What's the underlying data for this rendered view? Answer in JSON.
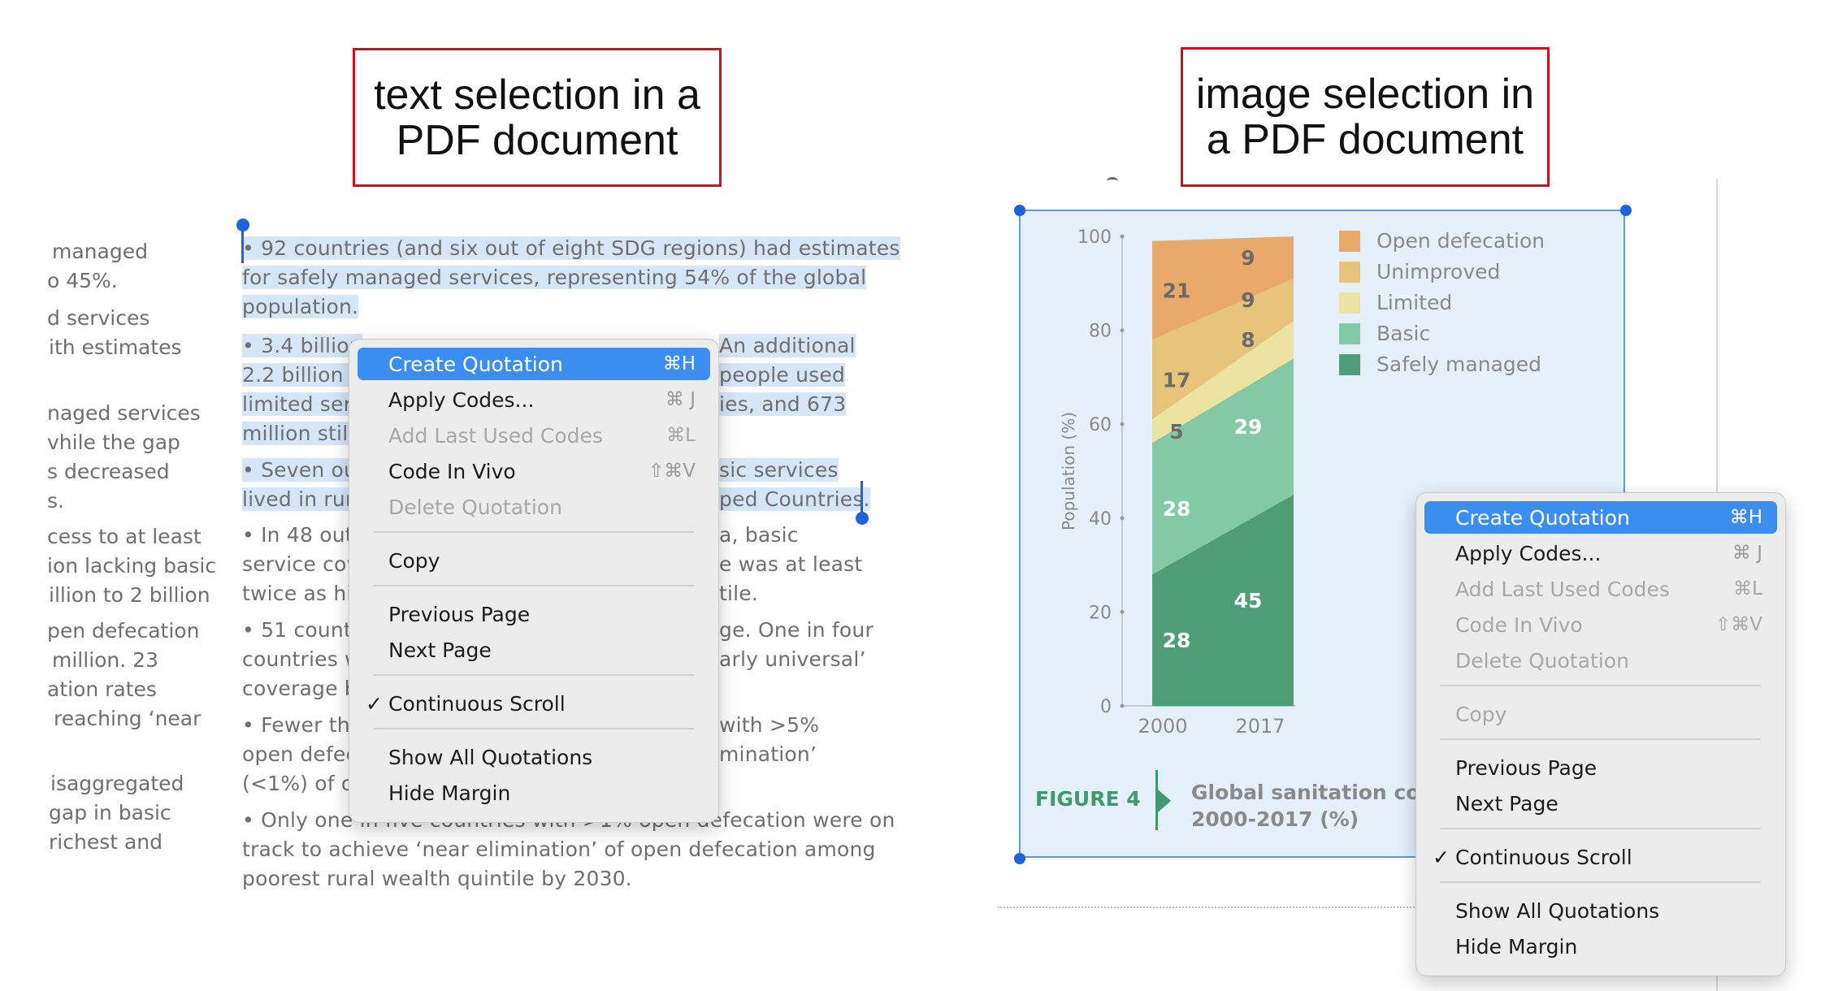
{
  "captions": {
    "left": "text selection in a PDF document",
    "right": "image selection in a PDF document"
  },
  "left_margin_lines": [
    "managed",
    "o 45%.",
    "d services",
    "ith estimates",
    "naged services",
    "vhile the gap",
    "s decreased",
    "s.",
    "cess to at least",
    "ion lacking basic",
    "illion to 2 billion",
    "pen defecation",
    "million. 23",
    "ation rates",
    "reaching ‘near",
    "isaggregated",
    "gap in basic",
    "richest and"
  ],
  "pdf_text": {
    "p1": [
      "•  92 countries (and six out of eight SDG regions) had estimates",
      "for safely managed services, representing 54% of the global",
      "population."
    ],
    "p2_left": [
      "•  3.4 billion",
      "2.2 billion u",
      "limited serv",
      "million still"
    ],
    "p2_right": [
      "An additional",
      "people used",
      "ies, and 673"
    ],
    "p3_left": [
      "•  Seven ou",
      "lived in rura"
    ],
    "p3_right": [
      "sic services",
      "ped Countries."
    ],
    "p4_left": [
      "•  In 48 out",
      "service cov",
      "twice as hig"
    ],
    "p4_right": [
      "a, basic",
      "e was at least",
      "tile."
    ],
    "p5_left": [
      "•  51 count",
      "countries w",
      "coverage b"
    ],
    "p5_right": [
      "ge. One in four",
      "arly universal’"
    ],
    "p6_left": [
      "•  Fewer th",
      "open defec",
      "(<1%) of op"
    ],
    "p6_right": [
      "with >5%",
      "mination’"
    ],
    "p7": [
      "•  Only one in five countries with >1% open defecation were on",
      "track to achieve ‘near elimination’ of open defecation among",
      "poorest rural wealth quintile by 2030."
    ]
  },
  "context_menu": {
    "items": [
      {
        "label": "Create Quotation",
        "shortcut": "⌘H",
        "state": "active"
      },
      {
        "label": "Apply Codes...",
        "shortcut": "⌘ J",
        "state": "normal"
      },
      {
        "label": "Add Last Used Codes",
        "shortcut": "⌘L",
        "state": "disabled"
      },
      {
        "label": "Code In Vivo",
        "shortcut": "⇧⌘V",
        "state": "normal"
      },
      {
        "label": "Delete Quotation",
        "shortcut": "",
        "state": "disabled"
      },
      {
        "label": "Copy",
        "shortcut": "",
        "state": "normal"
      },
      {
        "label": "Previous Page",
        "shortcut": "",
        "state": "normal"
      },
      {
        "label": "Next Page",
        "shortcut": "",
        "state": "normal"
      },
      {
        "label": "Continuous Scroll",
        "shortcut": "",
        "state": "checked"
      },
      {
        "label": "Show All Quotations",
        "shortcut": "",
        "state": "normal"
      },
      {
        "label": "Hide Margin",
        "shortcut": "",
        "state": "normal"
      }
    ]
  },
  "context_menu_right": {
    "items": [
      {
        "label": "Create Quotation",
        "shortcut": "⌘H",
        "state": "active"
      },
      {
        "label": "Apply Codes...",
        "shortcut": "⌘ J",
        "state": "normal"
      },
      {
        "label": "Add Last Used Codes",
        "shortcut": "⌘L",
        "state": "disabled"
      },
      {
        "label": "Code In Vivo",
        "shortcut": "⇧⌘V",
        "state": "disabled"
      },
      {
        "label": "Delete Quotation",
        "shortcut": "",
        "state": "disabled"
      },
      {
        "label": "Copy",
        "shortcut": "",
        "state": "disabled"
      },
      {
        "label": "Previous Page",
        "shortcut": "",
        "state": "normal"
      },
      {
        "label": "Next Page",
        "shortcut": "",
        "state": "normal"
      },
      {
        "label": "Continuous Scroll",
        "shortcut": "",
        "state": "checked"
      },
      {
        "label": "Show All Quotations",
        "shortcut": "",
        "state": "normal"
      },
      {
        "label": "Hide Margin",
        "shortcut": "",
        "state": "normal"
      }
    ]
  },
  "figure": {
    "label": "FIGURE 4",
    "caption_line1": "Global sanitation cove",
    "caption_line2": "2000-2017 (%)",
    "colors": {
      "open": "#e8a96a",
      "unimproved": "#e6c479",
      "limited": "#ece3a3",
      "basic": "#82c9a6",
      "safely": "#4f9d74"
    }
  },
  "chart_data": {
    "type": "bar",
    "stacked": true,
    "categories": [
      "2000",
      "2017"
    ],
    "ylabel": "Population (%)",
    "ylim": [
      0,
      100
    ],
    "yticks": [
      0,
      20,
      40,
      60,
      80,
      100
    ],
    "series": [
      {
        "name": "Safely managed",
        "values": [
          28,
          45
        ],
        "color": "#4f9d74"
      },
      {
        "name": "Basic",
        "values": [
          28,
          29
        ],
        "color": "#82c9a6"
      },
      {
        "name": "Limited",
        "values": [
          5,
          8
        ],
        "color": "#ece3a3"
      },
      {
        "name": "Unimproved",
        "values": [
          17,
          9
        ],
        "color": "#e6c479"
      },
      {
        "name": "Open defecation",
        "values": [
          21,
          9
        ],
        "color": "#e8a96a"
      }
    ],
    "legend": [
      "Open defecation",
      "Unimproved",
      "Limited",
      "Basic",
      "Safely managed"
    ],
    "legend_position": "top-right"
  }
}
